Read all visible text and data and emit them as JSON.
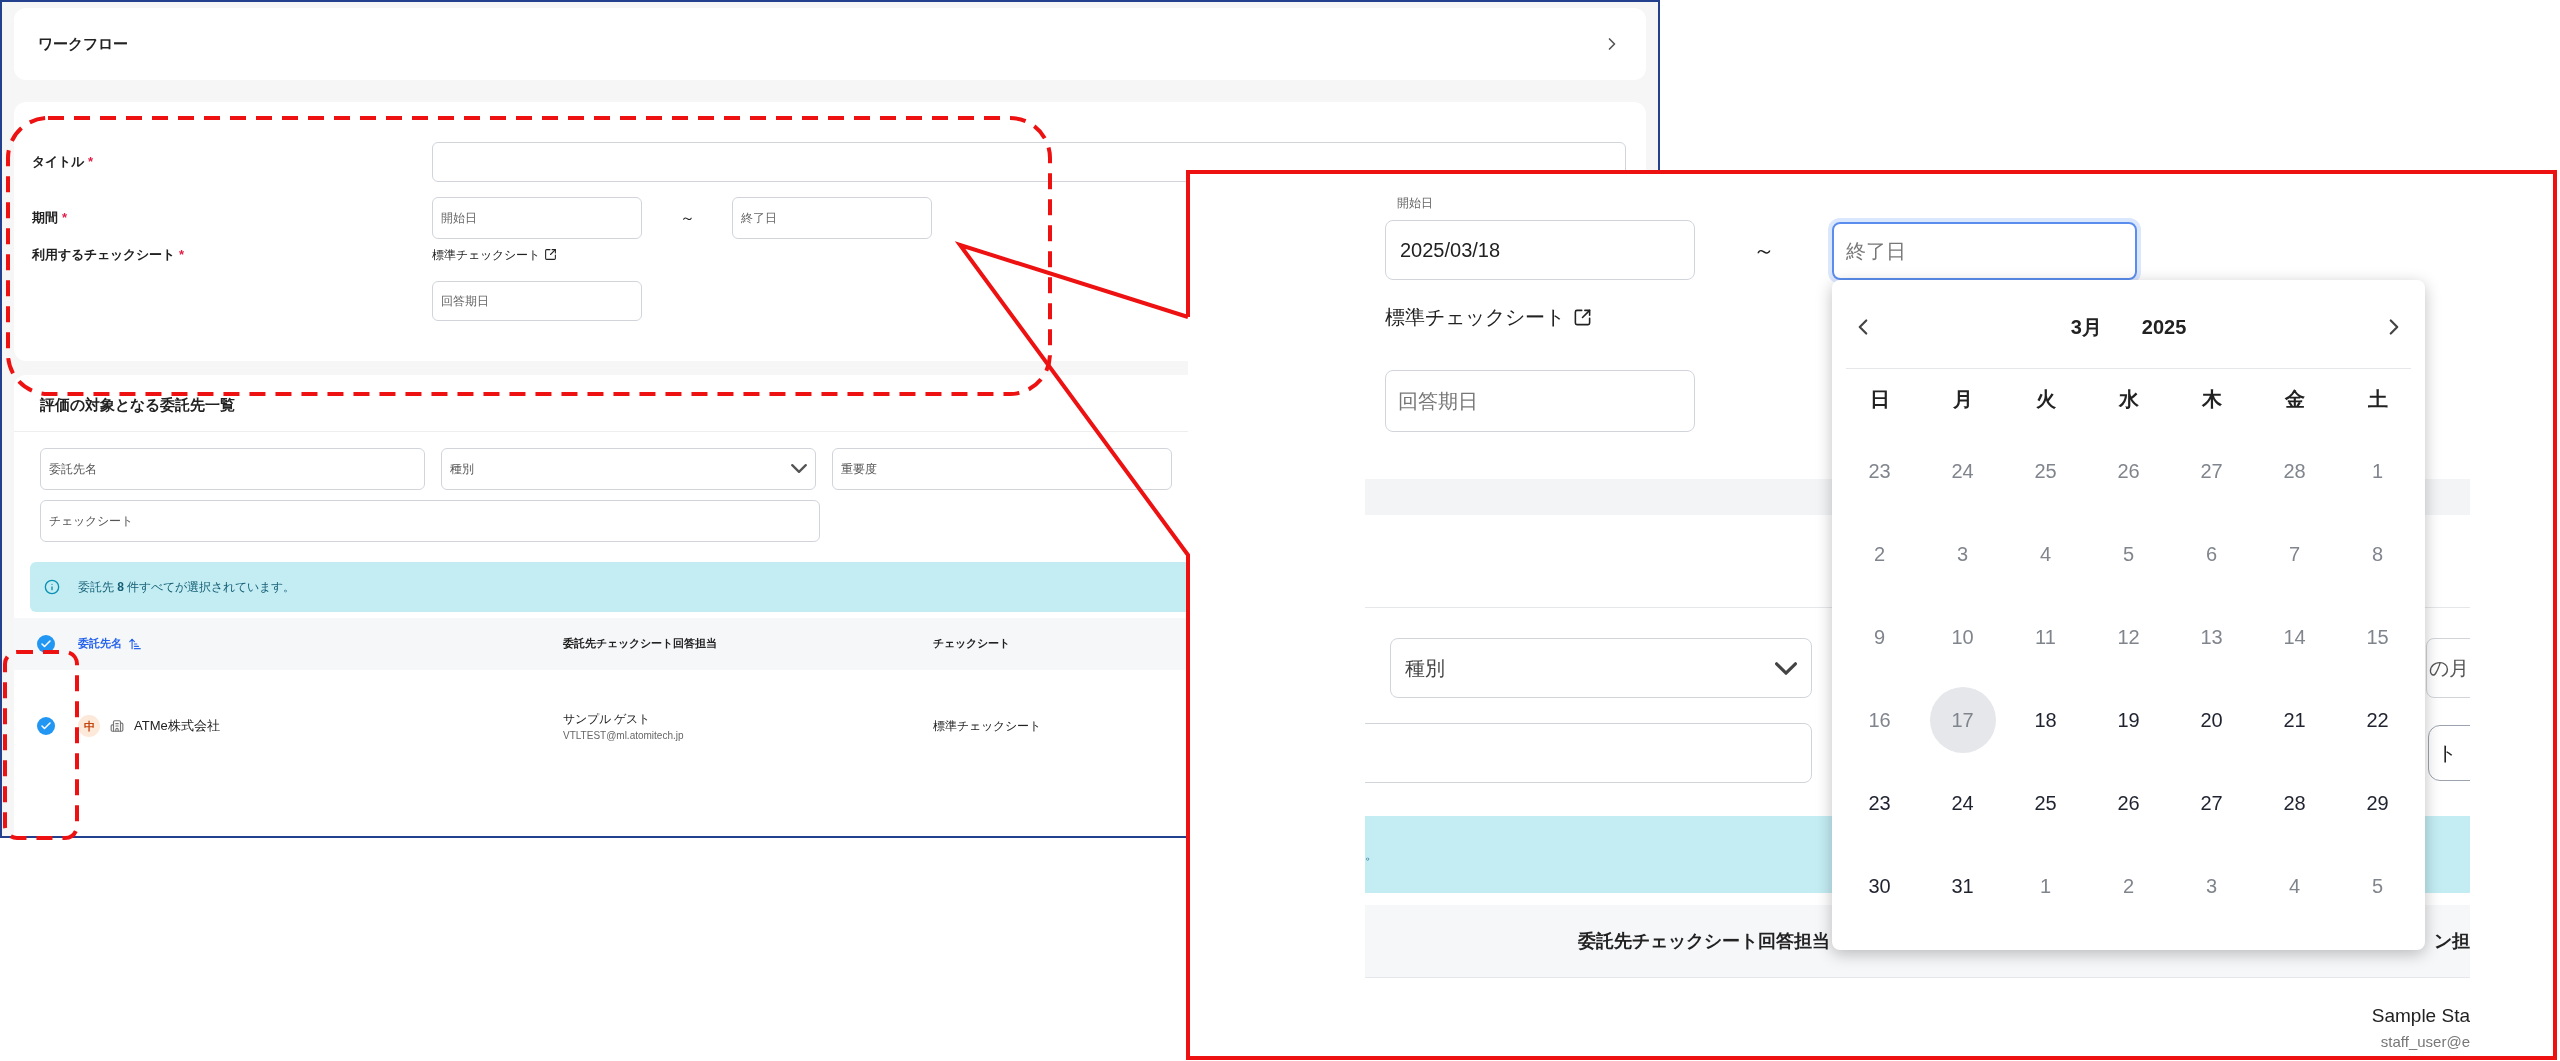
{
  "header": {
    "title": "ワークフロー"
  },
  "form": {
    "title": {
      "label": "タイトル",
      "required_mark": "*"
    },
    "period": {
      "label": "期間",
      "required_mark": "*",
      "start_placeholder": "開始日",
      "separator": "～",
      "end_placeholder": "終了日"
    },
    "checksheet": {
      "label": "利用するチェックシート",
      "required_mark": "*",
      "link": "標準チェックシート",
      "due_placeholder": "回答期日"
    }
  },
  "list": {
    "title": "評価の対象となる委託先一覧",
    "filters": [
      {
        "placeholder": "委託先名",
        "kind": "text"
      },
      {
        "placeholder": "種別",
        "kind": "select"
      },
      {
        "placeholder": "重要度",
        "kind": "text"
      },
      {
        "placeholder": "チェックシート",
        "kind": "text"
      }
    ],
    "banner": "委託先 **8** 件すべてが選択されています。",
    "all_checked": true,
    "columns": [
      {
        "label": "委託先名",
        "sorted": true
      },
      {
        "label": "委託先チェックシート回答担当",
        "sorted": false
      },
      {
        "label": "チェックシート",
        "sorted": false
      }
    ],
    "rows": [
      {
        "checked": true,
        "priority": "中",
        "name": "ATMe株式会社",
        "contact": "サンプル ゲスト",
        "email": "VTLTEST@ml.atomitech.jp",
        "checksheet": "標準チェックシート"
      }
    ]
  },
  "zoom_view": {
    "start_label": "開始日",
    "start_value": "2025/03/18",
    "separator": "～",
    "end_placeholder": "終了日",
    "end_focused": true,
    "link": "標準チェックシート",
    "due_placeholder": "回答期日",
    "filter_select": "種別",
    "partial_filter": "の月",
    "partial_button": "ト",
    "banner_tail": "。",
    "column_header": "委託先チェックシート回答担当",
    "partial_column": "ン担",
    "row_name": "Sample Sta",
    "row_email": "staff_user@e",
    "calendar": {
      "month": "3月",
      "year": "2025",
      "weekdays": [
        "日",
        "月",
        "火",
        "水",
        "木",
        "金",
        "土"
      ],
      "weeks": [
        [
          {
            "day": "23",
            "disabled": true,
            "today": false
          },
          {
            "day": "24",
            "disabled": true,
            "today": false
          },
          {
            "day": "25",
            "disabled": true,
            "today": false
          },
          {
            "day": "26",
            "disabled": true,
            "today": false
          },
          {
            "day": "27",
            "disabled": true,
            "today": false
          },
          {
            "day": "28",
            "disabled": true,
            "today": false
          },
          {
            "day": "1",
            "disabled": true,
            "today": false
          }
        ],
        [
          {
            "day": "2",
            "disabled": true,
            "today": false
          },
          {
            "day": "3",
            "disabled": true,
            "today": false
          },
          {
            "day": "4",
            "disabled": true,
            "today": false
          },
          {
            "day": "5",
            "disabled": true,
            "today": false
          },
          {
            "day": "6",
            "disabled": true,
            "today": false
          },
          {
            "day": "7",
            "disabled": true,
            "today": false
          },
          {
            "day": "8",
            "disabled": true,
            "today": false
          }
        ],
        [
          {
            "day": "9",
            "disabled": true,
            "today": false
          },
          {
            "day": "10",
            "disabled": true,
            "today": false
          },
          {
            "day": "11",
            "disabled": true,
            "today": false
          },
          {
            "day": "12",
            "disabled": true,
            "today": false
          },
          {
            "day": "13",
            "disabled": true,
            "today": false
          },
          {
            "day": "14",
            "disabled": true,
            "today": false
          },
          {
            "day": "15",
            "disabled": true,
            "today": false
          }
        ],
        [
          {
            "day": "16",
            "disabled": true,
            "today": false
          },
          {
            "day": "17",
            "disabled": true,
            "today": true
          },
          {
            "day": "18",
            "disabled": false,
            "today": false
          },
          {
            "day": "19",
            "disabled": false,
            "today": false
          },
          {
            "day": "20",
            "disabled": false,
            "today": false
          },
          {
            "day": "21",
            "disabled": false,
            "today": false
          },
          {
            "day": "22",
            "disabled": false,
            "today": false
          }
        ],
        [
          {
            "day": "23",
            "disabled": false,
            "today": false
          },
          {
            "day": "24",
            "disabled": false,
            "today": false
          },
          {
            "day": "25",
            "disabled": false,
            "today": false
          },
          {
            "day": "26",
            "disabled": false,
            "today": false
          },
          {
            "day": "27",
            "disabled": false,
            "today": false
          },
          {
            "day": "28",
            "disabled": false,
            "today": false
          },
          {
            "day": "29",
            "disabled": false,
            "today": false
          }
        ],
        [
          {
            "day": "30",
            "disabled": false,
            "today": false
          },
          {
            "day": "31",
            "disabled": false,
            "today": false
          },
          {
            "day": "1",
            "disabled": true,
            "today": false
          },
          {
            "day": "2",
            "disabled": true,
            "today": false
          },
          {
            "day": "3",
            "disabled": true,
            "today": false
          },
          {
            "day": "4",
            "disabled": true,
            "today": false
          },
          {
            "day": "5",
            "disabled": true,
            "today": false
          }
        ]
      ]
    }
  }
}
